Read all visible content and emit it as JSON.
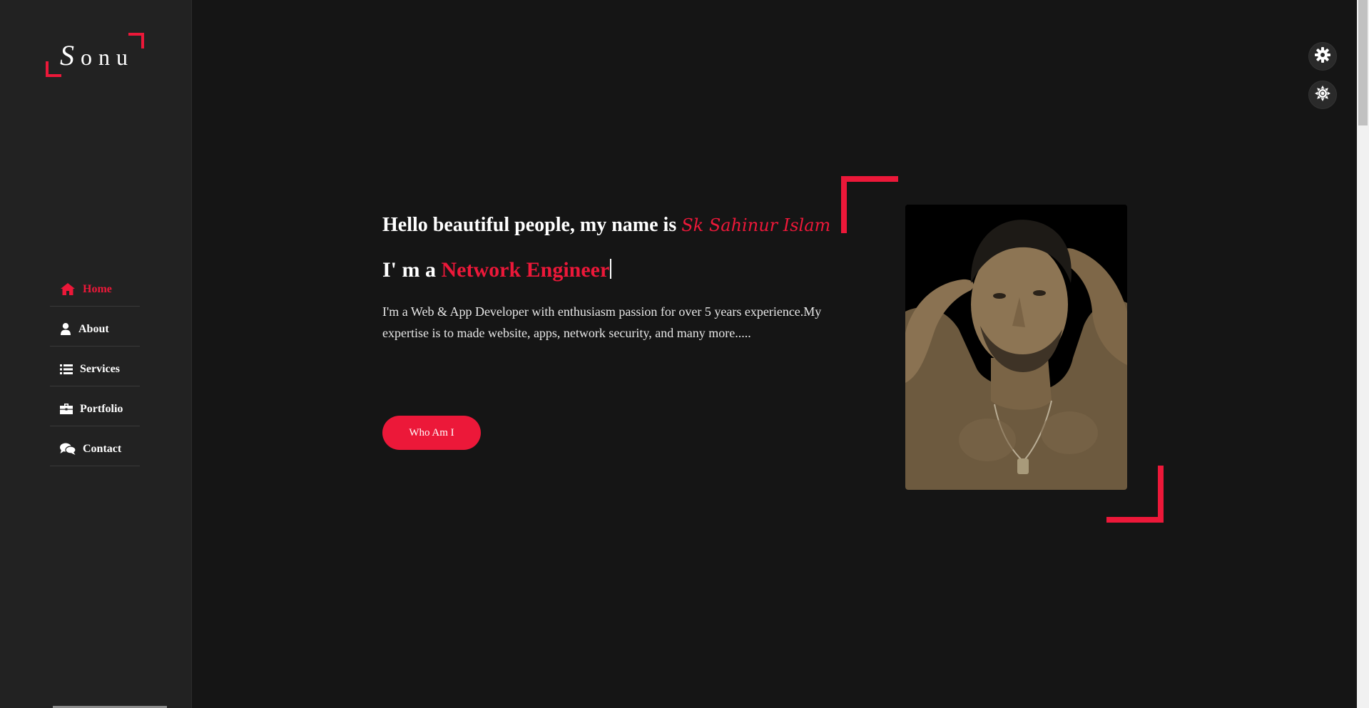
{
  "logo": {
    "first_letter": "S",
    "rest": "onu"
  },
  "nav": {
    "items": [
      {
        "label": "Home",
        "icon": "home-icon",
        "active": true
      },
      {
        "label": "About",
        "icon": "user-icon",
        "active": false
      },
      {
        "label": "Services",
        "icon": "list-icon",
        "active": false
      },
      {
        "label": "Portfolio",
        "icon": "briefcase-icon",
        "active": false
      },
      {
        "label": "Contact",
        "icon": "comments-icon",
        "active": false
      }
    ]
  },
  "hero": {
    "greeting": "Hello beautiful people, my name is ",
    "name": "Sk Sahinur Islam",
    "role_prefix": "I' m a ",
    "role": "Network Engineer",
    "description": "I'm a Web & App Developer with enthusiasm passion for over 5 years experience.My expertise is to made website, apps, network security, and many more.....",
    "cta_label": "Who Am I"
  },
  "controls": {
    "settings_icon": "gear-icon",
    "theme_icon": "sun-icon"
  },
  "colors": {
    "accent": "#ec1839",
    "background": "#151515",
    "sidebar": "#222222"
  }
}
